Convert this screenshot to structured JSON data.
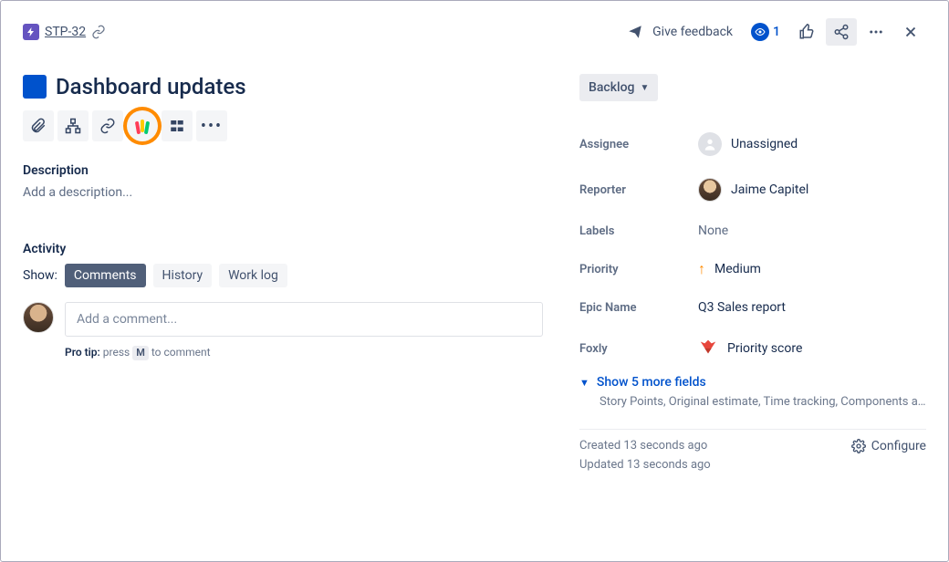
{
  "breadcrumb": {
    "issue_key": "STP-32"
  },
  "header_actions": {
    "feedback": "Give feedback",
    "watch_count": "1"
  },
  "title": "Dashboard updates",
  "description": {
    "label": "Description",
    "placeholder": "Add a description..."
  },
  "activity": {
    "heading": "Activity",
    "show_label": "Show:",
    "tabs": {
      "comments": "Comments",
      "history": "History",
      "worklog": "Work log"
    },
    "comment_placeholder": "Add a comment...",
    "protip_prefix": "Pro tip:",
    "protip_press": "press",
    "protip_key": "M",
    "protip_suffix": "to comment"
  },
  "status": {
    "label": "Backlog"
  },
  "details": {
    "assignee": {
      "label": "Assignee",
      "value": "Unassigned"
    },
    "reporter": {
      "label": "Reporter",
      "value": "Jaime Capitel"
    },
    "labels": {
      "label": "Labels",
      "value": "None"
    },
    "priority": {
      "label": "Priority",
      "value": "Medium"
    },
    "epicName": {
      "label": "Epic Name",
      "value": "Q3 Sales report"
    },
    "foxly": {
      "label": "Foxly",
      "value": "Priority score"
    }
  },
  "show_more": {
    "label": "Show 5 more fields",
    "description": "Story Points, Original estimate, Time tracking, Components and ..."
  },
  "meta": {
    "created": "Created 13 seconds ago",
    "updated": "Updated 13 seconds ago",
    "configure": "Configure"
  }
}
